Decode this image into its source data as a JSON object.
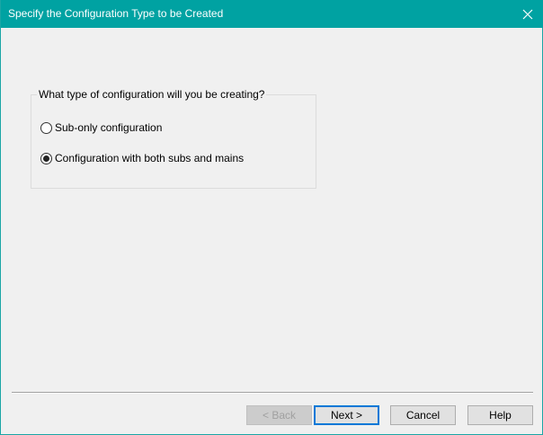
{
  "window": {
    "title": "Specify the Configuration Type to be Created",
    "close_icon": "close-icon",
    "accent_color": "#00a2a2"
  },
  "group": {
    "legend": "What type of configuration will you be creating?",
    "options": [
      {
        "label": "Sub-only configuration",
        "selected": false
      },
      {
        "label": "Configuration with both subs and mains",
        "selected": true
      }
    ]
  },
  "buttons": {
    "back": {
      "label": "< Back",
      "enabled": false
    },
    "next": {
      "label": "Next >",
      "default": true
    },
    "cancel": {
      "label": "Cancel"
    },
    "help": {
      "label": "Help"
    }
  }
}
